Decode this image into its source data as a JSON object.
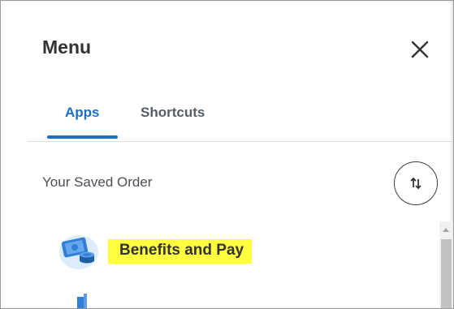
{
  "menu": {
    "title": "Menu",
    "close_icon": "close-icon"
  },
  "tabs": [
    {
      "label": "Apps",
      "active": true
    },
    {
      "label": "Shortcuts",
      "active": false
    }
  ],
  "order": {
    "label": "Your Saved Order",
    "sort_icon": "sort-arrows-icon"
  },
  "apps": [
    {
      "label": "Benefits and Pay",
      "icon": "benefits-pay-icon",
      "highlight": "#ffff40"
    }
  ],
  "colors": {
    "accent": "#1b6fc6",
    "highlight": "#ffff40",
    "text": "#333333"
  }
}
